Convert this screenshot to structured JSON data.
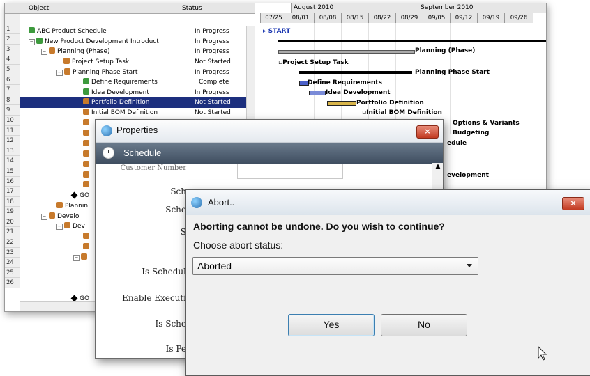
{
  "project": {
    "header": {
      "object": "Object",
      "status": "Status"
    },
    "row_numbers": [
      "1",
      "2",
      "3",
      "4",
      "5",
      "6",
      "7",
      "8",
      "9",
      "10",
      "11",
      "12",
      "13",
      "14",
      "15",
      "16",
      "17",
      "18",
      "19",
      "20",
      "21",
      "22",
      "23",
      "24",
      "25",
      "26"
    ],
    "rows": [
      {
        "label": "ABC Product Schedule",
        "status": "In Progress"
      },
      {
        "label": "New Product Development Introduct",
        "status": "In Progress"
      },
      {
        "label": "Planning  (Phase)",
        "status": "In Progress"
      },
      {
        "label": "Project Setup Task",
        "status": "Not Started"
      },
      {
        "label": "Planning Phase Start",
        "status": "In Progress"
      },
      {
        "label": "Define Requirements",
        "status": "Complete"
      },
      {
        "label": "Idea Development",
        "status": "In Progress"
      },
      {
        "label": "Portfolio Definition",
        "status": "Not Started"
      },
      {
        "label": "Initial BOM Definition",
        "status": "Not Started"
      },
      {
        "label": "GO",
        "status": ""
      },
      {
        "label": "Plannin",
        "status": ""
      },
      {
        "label": "Develo",
        "status": ""
      },
      {
        "label": "Dev",
        "status": ""
      },
      {
        "label": "GO",
        "status": ""
      }
    ],
    "gantt": {
      "months": [
        "August 2010",
        "September 2010"
      ],
      "weeks": [
        "07/25",
        "08/01",
        "08/08",
        "08/15",
        "08/22",
        "08/29",
        "09/05",
        "09/12",
        "09/19",
        "09/26"
      ],
      "labels": {
        "start": "START",
        "planning_phase": "Planning  (Phase)",
        "project_setup": "Project Setup Task",
        "planning_phase_start": "Planning Phase Start",
        "define_req": "Define Requirements",
        "idea_dev": "Idea Development",
        "portfolio_def": "Portfolio Definition",
        "initial_bom": "Initial BOM Definition",
        "options": "Options & Variants",
        "budgeting": "Budgeting",
        "schedule_frag": "edule",
        "development_frag": "evelopment"
      }
    }
  },
  "properties": {
    "title": "Properties",
    "band_title": "Schedule",
    "labels": [
      "Sch",
      "Sche",
      "S",
      "Is Schedul",
      "Enable Executi",
      "Is Sche",
      "Is Pe"
    ],
    "customer_number_fragment": "Customer Number"
  },
  "abort": {
    "title": "Abort..",
    "message": "Aborting cannot be undone. Do you wish to continue?",
    "choose_label": "Choose abort status:",
    "selected_status": "Aborted",
    "yes_label": "Yes",
    "no_label": "No",
    "close_label": "×"
  },
  "colors": {
    "selection": "#1c2f7e",
    "band": "#4f5f72",
    "close": "#c23b22"
  }
}
